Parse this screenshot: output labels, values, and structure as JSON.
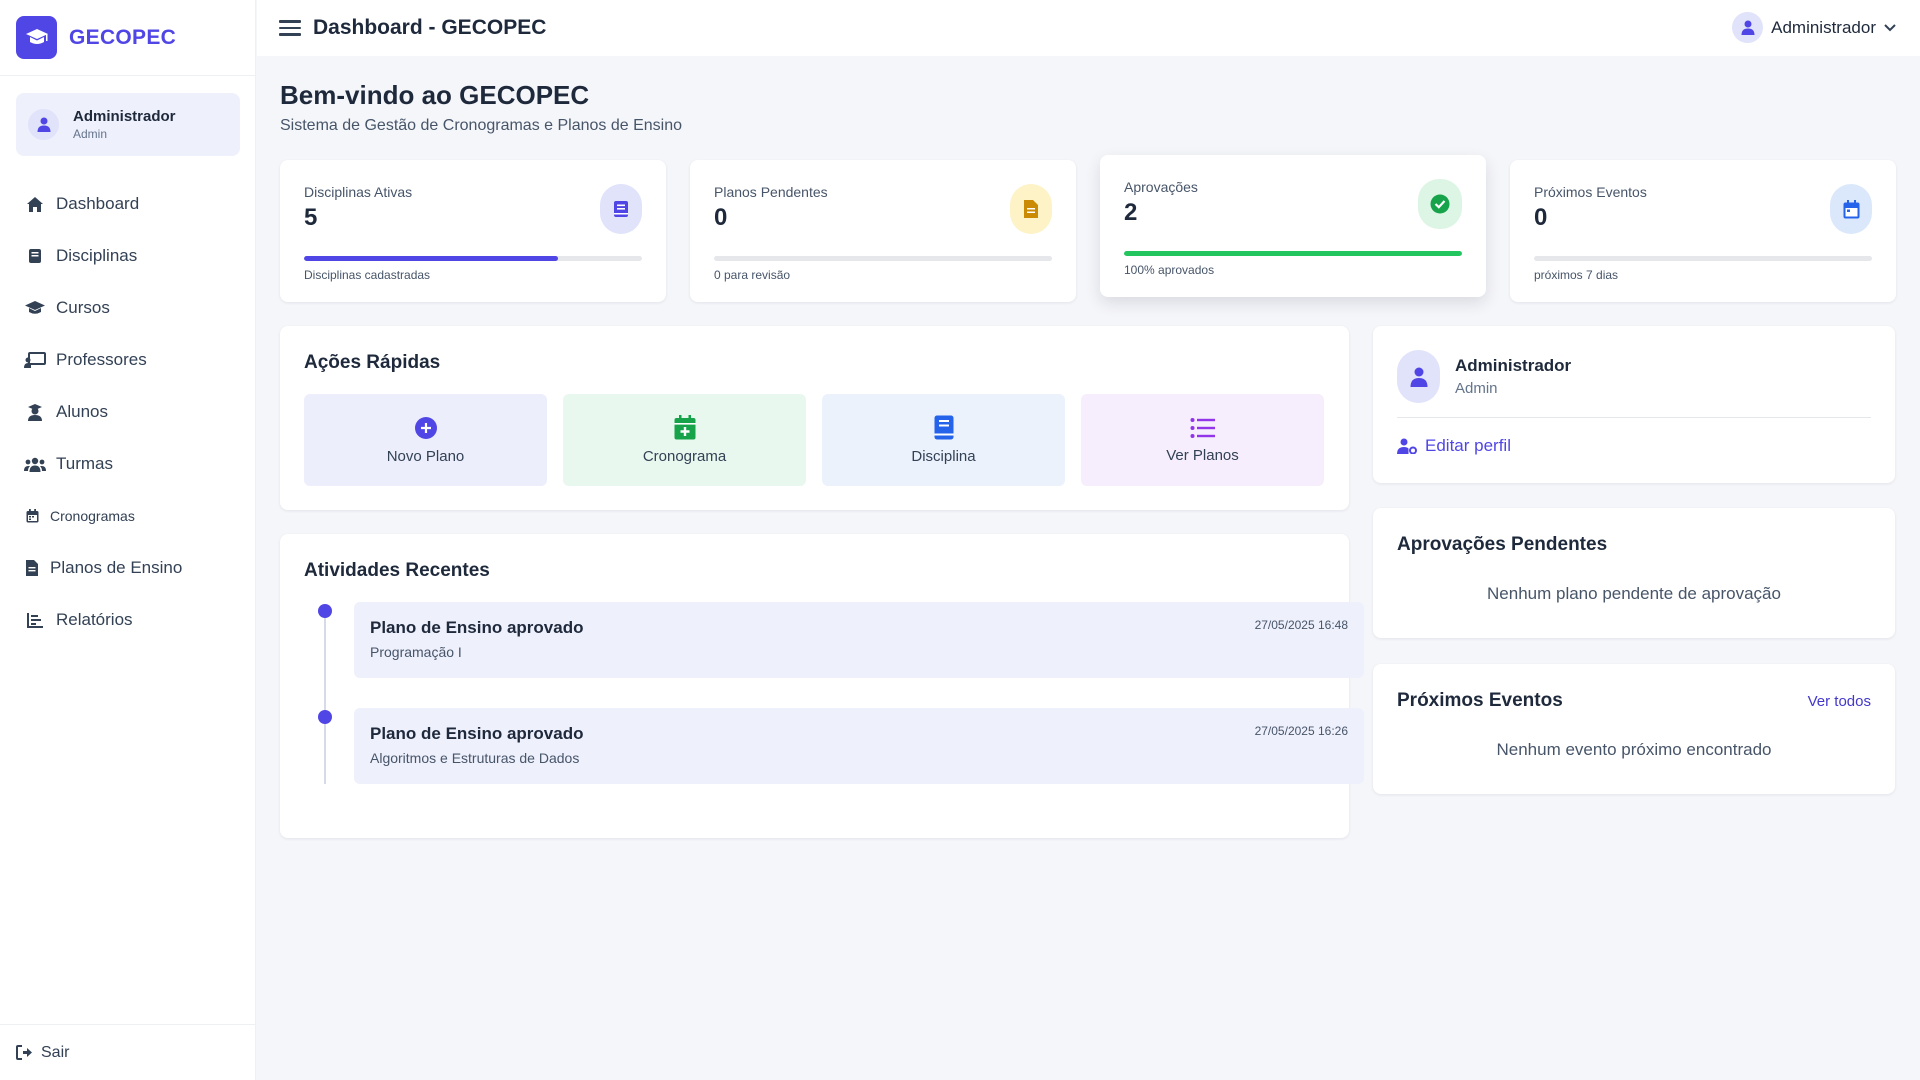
{
  "brand": {
    "name": "GECOPEC"
  },
  "sidebar": {
    "user": {
      "name": "Administrador",
      "role": "Admin"
    },
    "items": [
      {
        "label": "Dashboard",
        "icon": "home-icon"
      },
      {
        "label": "Disciplinas",
        "icon": "book-icon"
      },
      {
        "label": "Cursos",
        "icon": "graduation-cap-icon"
      },
      {
        "label": "Professores",
        "icon": "chalkboard-teacher-icon"
      },
      {
        "label": "Alunos",
        "icon": "student-icon"
      },
      {
        "label": "Turmas",
        "icon": "users-icon"
      },
      {
        "label": "Cronogramas",
        "icon": "calendar-icon"
      },
      {
        "label": "Planos de Ensino",
        "icon": "file-icon"
      },
      {
        "label": "Relatórios",
        "icon": "chart-icon"
      }
    ],
    "logout_label": "Sair"
  },
  "header": {
    "title": "Dashboard - GECOPEC",
    "user_label": "Administrador"
  },
  "welcome": {
    "title": "Bem-vindo ao GECOPEC",
    "subtitle": "Sistema de Gestão de Cronogramas e Planos de Ensino"
  },
  "stats": [
    {
      "label": "Disciplinas Ativas",
      "value": "5",
      "caption": "Disciplinas cadastradas",
      "progress": 0.75,
      "color": "#5046e5",
      "icon_bg": "#e0e3fa",
      "icon": "book-icon"
    },
    {
      "label": "Planos Pendentes",
      "value": "0",
      "caption": "0 para revisão",
      "progress": 0,
      "color": "#eab308",
      "icon_bg": "#fdf3c7",
      "icon": "file-icon"
    },
    {
      "label": "Aprovações",
      "value": "2",
      "caption": "100% aprovados",
      "progress": 1.0,
      "color": "#22c55e",
      "icon_bg": "#dcf5e4",
      "icon": "check-circle-icon"
    },
    {
      "label": "Próximos Eventos",
      "value": "0",
      "caption": "próximos 7 dias",
      "progress": 0,
      "color": "#3b82f6",
      "icon_bg": "#dbe8fb",
      "icon": "calendar-icon"
    }
  ],
  "quick_actions": {
    "title": "Ações Rápidas",
    "items": [
      {
        "label": "Novo Plano",
        "icon": "plus-circle-icon",
        "bg": "#eceefb",
        "color": "#5046e5"
      },
      {
        "label": "Cronograma",
        "icon": "calendar-plus-icon",
        "bg": "#e8f8ee",
        "color": "#16a34a"
      },
      {
        "label": "Disciplina",
        "icon": "book-icon",
        "bg": "#ebf2fc",
        "color": "#2563eb"
      },
      {
        "label": "Ver Planos",
        "icon": "list-icon",
        "bg": "#f6eefc",
        "color": "#9333ea"
      }
    ]
  },
  "activities": {
    "title": "Atividades Recentes",
    "items": [
      {
        "title": "Plano de Ensino aprovado",
        "subtitle": "Programação I",
        "date": "27/05/2025 16:48"
      },
      {
        "title": "Plano de Ensino aprovado",
        "subtitle": "Algoritmos e Estruturas de Dados",
        "date": "27/05/2025 16:26"
      }
    ]
  },
  "profile": {
    "name": "Administrador",
    "role": "Admin",
    "edit_label": "Editar perfil"
  },
  "pending": {
    "title": "Aprovações Pendentes",
    "empty": "Nenhum plano pendente de aprovação"
  },
  "events": {
    "title": "Próximos Eventos",
    "see_all": "Ver todos",
    "empty": "Nenhum evento próximo encontrado"
  }
}
